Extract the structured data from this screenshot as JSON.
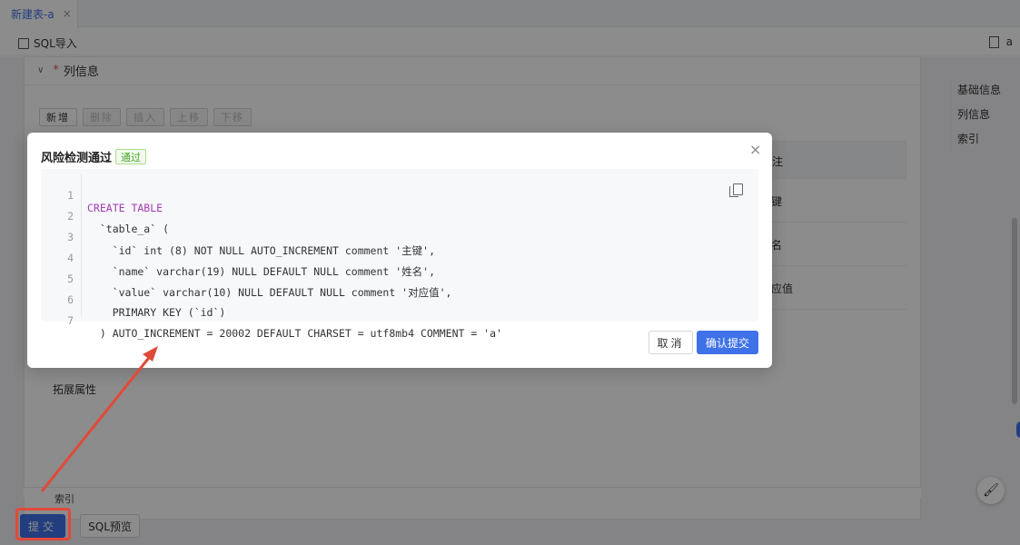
{
  "tabs": [
    {
      "label": "新建表-a",
      "close": "×"
    }
  ],
  "toolbar": {
    "sql_import": "SQL导入",
    "right_label": "a"
  },
  "section": {
    "chevron": "∨",
    "required_mark": "*",
    "title": "列信息"
  },
  "actions": {
    "add": "新增",
    "delete": "删除",
    "insert": "插入",
    "move_up": "上移",
    "move_down": "下移"
  },
  "table": {
    "column_header": "注",
    "cells": [
      "键",
      "名",
      "应值"
    ]
  },
  "ext_title": "拓展属性",
  "index_title": "索引",
  "sidenav": [
    "基础信息",
    "列信息",
    "索引"
  ],
  "bottom": {
    "submit": "提交",
    "sql_preview": "SQL预览"
  },
  "modal": {
    "title": "风险检测通过",
    "badge": "通过",
    "close": "×",
    "code_lines": [
      {
        "n": "1",
        "text": "CREATE TABLE"
      },
      {
        "n": "2",
        "text": "  `table_a` ("
      },
      {
        "n": "3",
        "text": "    `id` int (8) NOT NULL AUTO_INCREMENT comment '主键',"
      },
      {
        "n": "4",
        "text": "    `name` varchar(19) NULL DEFAULT NULL comment '姓名',"
      },
      {
        "n": "5",
        "text": "    `value` varchar(10) NULL DEFAULT NULL comment '对应值',"
      },
      {
        "n": "6",
        "text": "    PRIMARY KEY (`id`)"
      },
      {
        "n": "7",
        "text": "  ) AUTO_INCREMENT = 20002 DEFAULT CHARSET = utf8mb4 COMMENT = 'a'"
      }
    ],
    "cancel": "取消",
    "confirm": "确认提交"
  },
  "colors": {
    "primary": "#3f72e8",
    "success": "#4aa52a",
    "annotation": "#e04a3a"
  }
}
